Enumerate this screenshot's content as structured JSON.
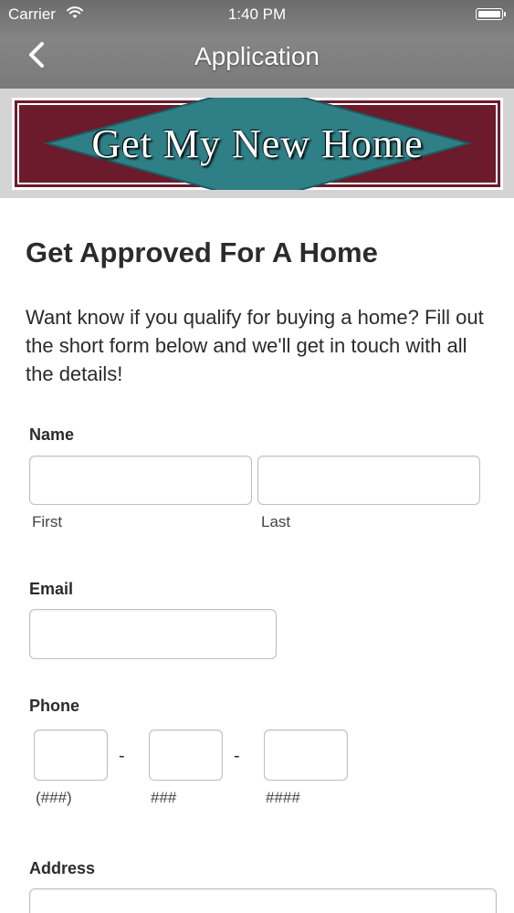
{
  "status_bar": {
    "carrier": "Carrier",
    "time": "1:40 PM",
    "wifi_icon": "wifi-icon",
    "battery_icon": "battery-icon"
  },
  "nav": {
    "title": "Application",
    "back_icon": "chevron-left-icon"
  },
  "banner": {
    "text": "Get My New Home",
    "colors": {
      "maroon": "#6b1b2c",
      "teal": "#2f7f86",
      "border": "#ffffff"
    }
  },
  "form": {
    "heading": "Get Approved For A Home",
    "intro": "Want know if you qualify for buying a home? Fill out the short form below and we'll get in touch with all the details!",
    "name": {
      "label": "Name",
      "first_sublabel": "First",
      "last_sublabel": "Last",
      "first_value": "",
      "last_value": ""
    },
    "email": {
      "label": "Email",
      "value": ""
    },
    "phone": {
      "label": "Phone",
      "area_sublabel": "(###)",
      "prefix_sublabel": "###",
      "line_sublabel": "####",
      "separator": "-"
    },
    "address": {
      "label": "Address"
    }
  }
}
